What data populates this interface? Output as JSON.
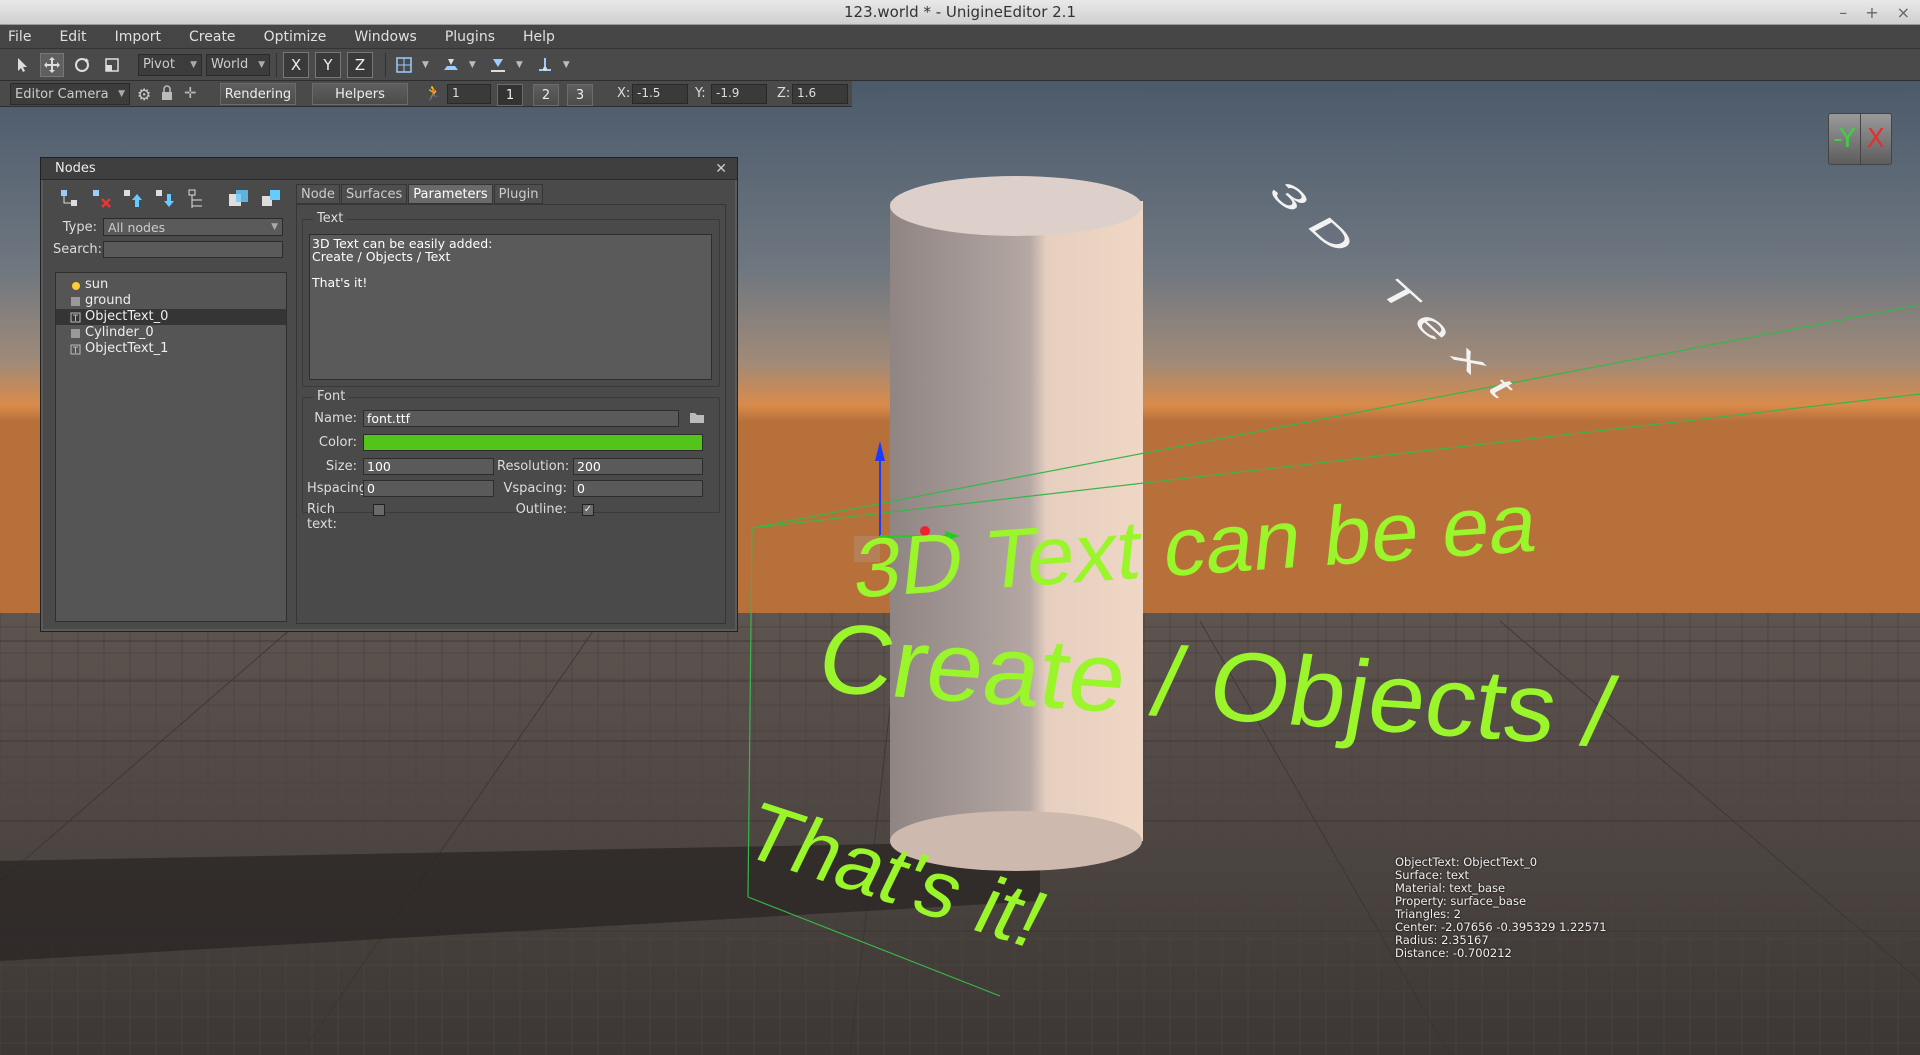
{
  "window": {
    "title": "123.world * - UnigineEditor 2.1",
    "controls": [
      "–",
      "+",
      "×"
    ]
  },
  "menu": [
    "File",
    "Edit",
    "Import",
    "Create",
    "Optimize",
    "Windows",
    "Plugins",
    "Help"
  ],
  "toolbar": {
    "pivot": "Pivot",
    "world": "World",
    "axes": [
      "X",
      "Y",
      "Z"
    ]
  },
  "toolbar2": {
    "camera": "Editor Camera",
    "rendering": "Rendering",
    "helpers": "Helpers",
    "step_value": "1",
    "step_buttons": [
      "1",
      "2",
      "3"
    ],
    "x_label": "X:",
    "x_value": "-1.5",
    "y_label": "Y:",
    "y_value": "-1.9",
    "z_label": "Z:",
    "z_value": "1.6"
  },
  "gizmo": {
    "y": "-Y",
    "x": "X"
  },
  "nodes_panel": {
    "title": "Nodes",
    "type_label": "Type:",
    "type_value": "All nodes",
    "search_label": "Search:",
    "search_value": "",
    "tree": [
      {
        "label": "sun",
        "icon": "sun-icon"
      },
      {
        "label": "ground",
        "icon": "object-icon"
      },
      {
        "label": "ObjectText_0",
        "icon": "text-object-icon",
        "selected": true
      },
      {
        "label": "Cylinder_0",
        "icon": "object-icon"
      },
      {
        "label": "ObjectText_1",
        "icon": "text-object-icon"
      }
    ],
    "tabs": [
      "Node",
      "Surfaces",
      "Parameters",
      "Plugin"
    ],
    "active_tab": "Parameters",
    "text_group": "Text",
    "text_content": "3D Text can be easily added:\nCreate / Objects / Text\n\nThat's it!",
    "font_group": "Font",
    "name_label": "Name:",
    "name_value": "font.ttf",
    "color_label": "Color:",
    "color_value": "#52c41a",
    "size_label": "Size:",
    "size_value": "100",
    "resolution_label": "Resolution:",
    "resolution_value": "200",
    "hspacing_label": "Hspacing:",
    "hspacing_value": "0",
    "vspacing_label": "Vspacing:",
    "vspacing_value": "0",
    "richtext_label": "Rich text:",
    "richtext_checked": false,
    "outline_label": "Outline:",
    "outline_checked": true
  },
  "scene": {
    "text_line1": "3D Text can be ea",
    "text_line2": "Create / Objects /",
    "text_line3": "That's it!",
    "floating_text": "3D Text",
    "text_color": "#9af52b"
  },
  "info_overlay": [
    "ObjectText: ObjectText_0",
    "Surface: text",
    "Material: text_base",
    "Property: surface_base",
    "Triangles: 2",
    "Center: -2.07656 -0.395329 1.22571",
    "Radius: 2.35167",
    "Distance: -0.700212"
  ]
}
